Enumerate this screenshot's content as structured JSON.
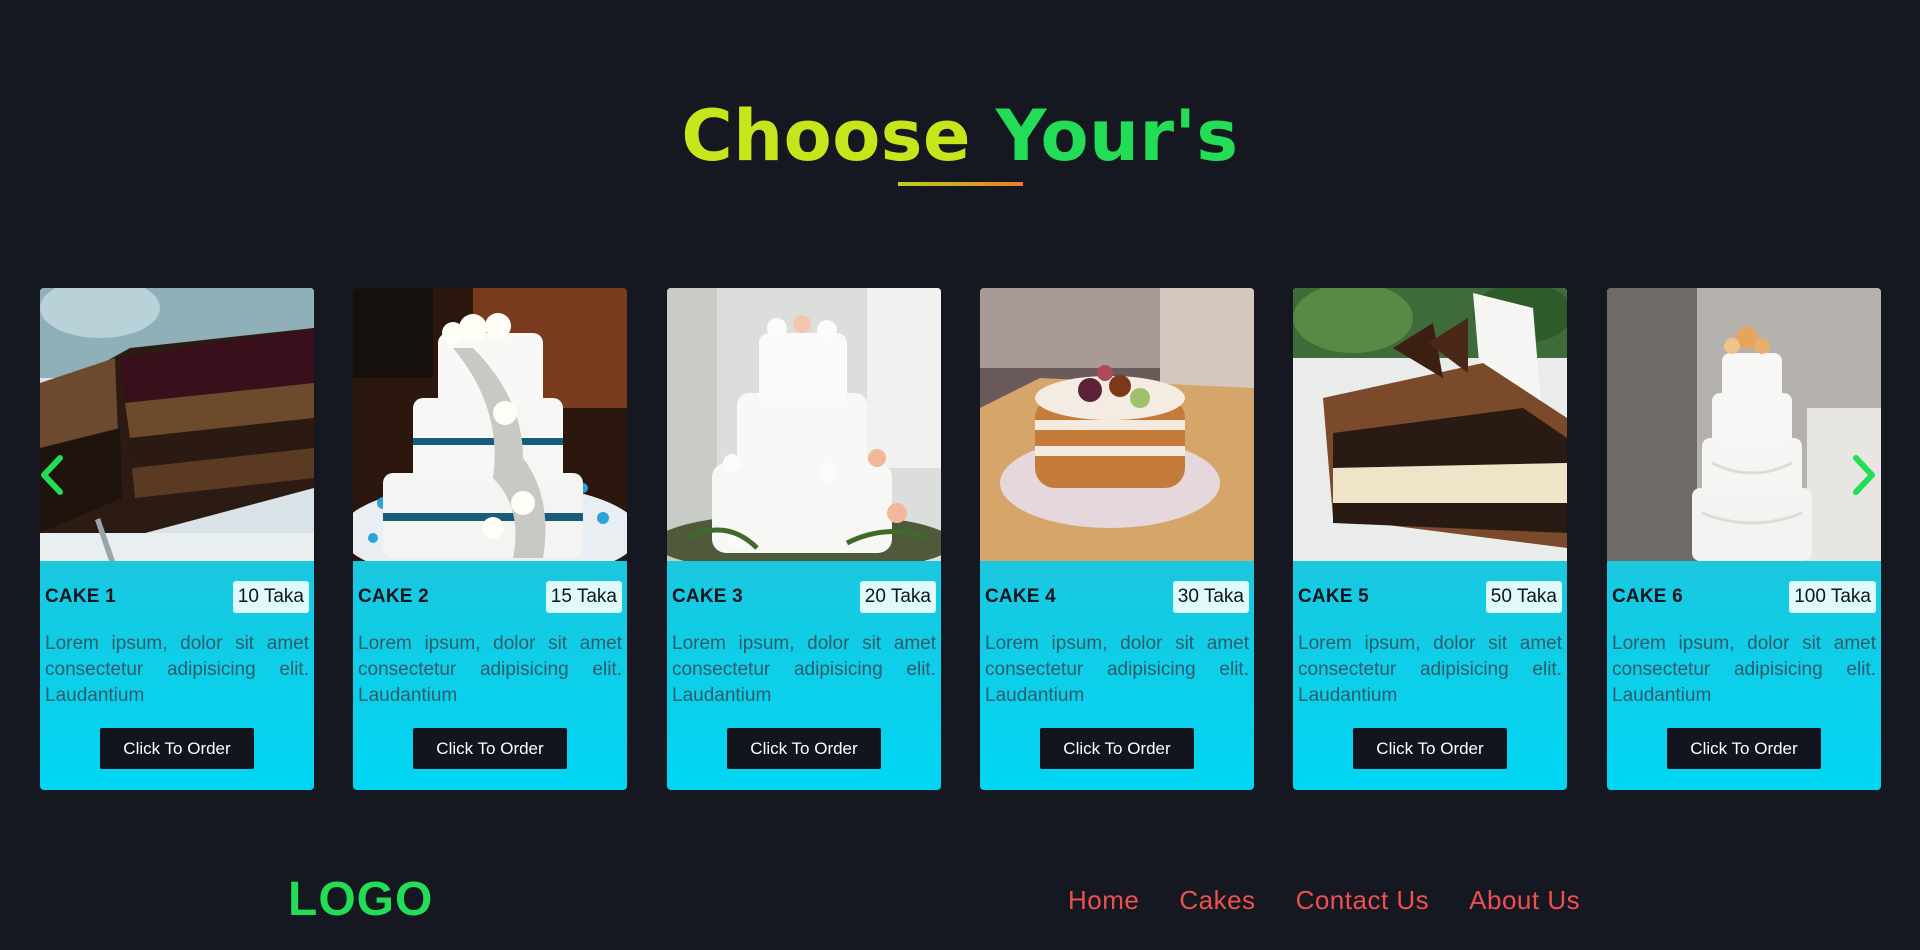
{
  "heading": {
    "word1": "Choose",
    "word2": "Your's"
  },
  "cards": [
    {
      "title": "CAKE 1",
      "price": "10 Taka",
      "description": "Lorem ipsum, dolor sit amet consectetur adipisicing elit. Laudantium",
      "button": "Click To Order",
      "image": "chocolate-layer-cake-slice"
    },
    {
      "title": "CAKE 2",
      "price": "15 Taka",
      "description": "Lorem ipsum, dolor sit amet consectetur adipisicing elit. Laudantium",
      "button": "Click To Order",
      "image": "white-tiered-wedding-cake-roses"
    },
    {
      "title": "CAKE 3",
      "price": "20 Taka",
      "description": "Lorem ipsum, dolor sit amet consectetur adipisicing elit. Laudantium",
      "button": "Click To Order",
      "image": "three-tier-floral-wedding-cake"
    },
    {
      "title": "CAKE 4",
      "price": "30 Taka",
      "description": "Lorem ipsum, dolor sit amet consectetur adipisicing elit. Laudantium",
      "button": "Click To Order",
      "image": "naked-fruit-cake"
    },
    {
      "title": "CAKE 5",
      "price": "50 Taka",
      "description": "Lorem ipsum, dolor sit amet consectetur adipisicing elit. Laudantium",
      "button": "Click To Order",
      "image": "chocolate-mousse-cake-slice"
    },
    {
      "title": "CAKE 6",
      "price": "100 Taka",
      "description": "Lorem ipsum, dolor sit amet consectetur adipisicing elit. Laudantium",
      "button": "Click To Order",
      "image": "white-ruffle-tall-cake"
    }
  ],
  "carousel": {
    "prev_icon": "chevron-left-icon",
    "next_icon": "chevron-right-icon"
  },
  "footer": {
    "logo": "LOGO",
    "nav": [
      "Home",
      "Cakes",
      "Contact Us",
      "About Us"
    ]
  },
  "colors": {
    "background": "#151821",
    "heading_word1": "#c6e51b",
    "heading_word2": "#22dd55",
    "accent_green": "#22dd55",
    "nav_link": "#ee4f4f",
    "card_gradient_top": "#3ab6c8",
    "card_gradient_bottom": "#00d6f3",
    "button_bg": "#12151d"
  }
}
